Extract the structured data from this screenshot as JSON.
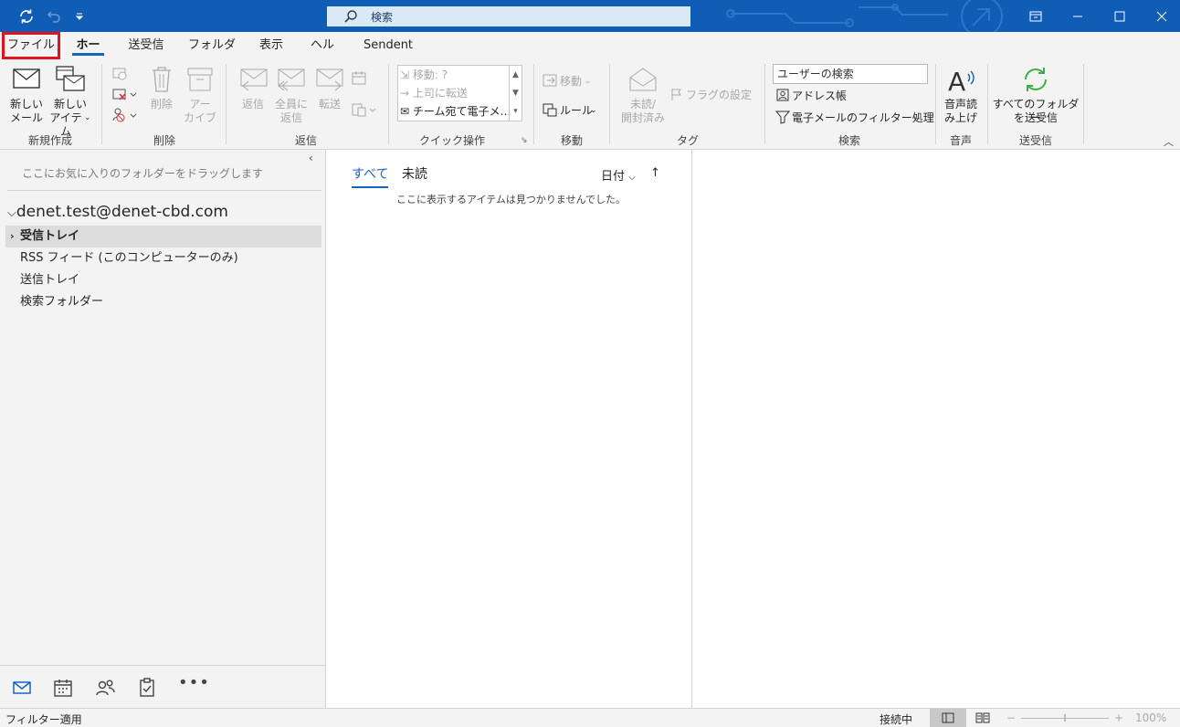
{
  "search": {
    "placeholder": "検索"
  },
  "ribbon_tabs": [
    "ファイル",
    "ホーム",
    "送受信",
    "フォルダー",
    "表示",
    "ヘルプ",
    "Sendent"
  ],
  "ribbon": {
    "new_mail": [
      "新しい",
      "メール"
    ],
    "new_items": [
      "新しい",
      "アイテム"
    ],
    "delete": "削除",
    "archive": [
      "アー",
      "カイブ"
    ],
    "reply": "返信",
    "reply_all": [
      "全員に",
      "返信"
    ],
    "forward": "転送",
    "quick_steps": [
      "移動: ?",
      "上司に転送",
      "チーム宛て電子メ…"
    ],
    "move": "移動",
    "rules": "ルール",
    "unread_read": [
      "未読/",
      "開封済み"
    ],
    "flag": "フラグの設定",
    "user_search": "ユーザーの検索",
    "address_book": "アドレス帳",
    "filter_mail": "電子メールのフィルター処理",
    "read_aloud": [
      "音声読",
      "み上げ"
    ],
    "send_receive_all": [
      "すべてのフォルダー",
      "を送受信"
    ],
    "groups": {
      "new": "新規作成",
      "delete": "削除",
      "respond": "返信",
      "quick_steps": "クイック操作",
      "move": "移動",
      "tags": "タグ",
      "find": "検索",
      "speech": "音声",
      "send_receive": "送受信"
    }
  },
  "folder_pane": {
    "favorites_hint": "ここにお気に入りのフォルダーをドラッグします",
    "account": "denet.test@denet-cbd.com",
    "folders": [
      "受信トレイ",
      "RSS フィード (このコンピューターのみ)",
      "送信トレイ",
      "検索フォルダー"
    ]
  },
  "message_list": {
    "tab_all": "すべて",
    "tab_unread": "未読",
    "sort_label": "日付",
    "sort_direction": "↑",
    "empty_text": "ここに表示するアイテムは見つかりませんでした。"
  },
  "status_bar": {
    "filter": "フィルター適用",
    "connection": "接続中",
    "zoom": "100%"
  },
  "colors": {
    "titlebar": "#0f5db5",
    "accent": "#1664c0",
    "highlight_box": "#e0141e"
  }
}
